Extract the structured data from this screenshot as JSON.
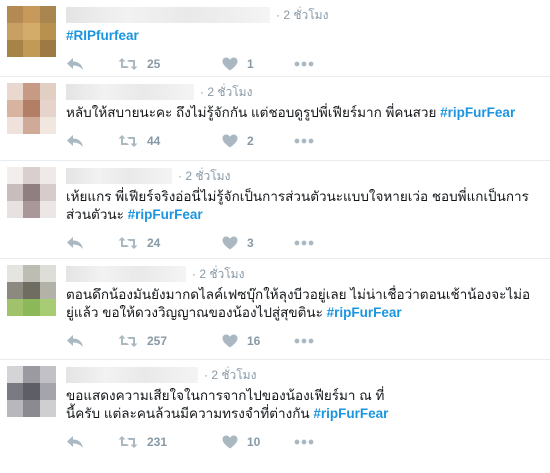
{
  "colors": {
    "hashtag": "#1b95e0",
    "icon": "#aab8c2",
    "text": "#14171a",
    "meta": "#8899a6"
  },
  "tweets": [
    {
      "time": "· 2 ชั่วโมง",
      "text_before": "",
      "hashtag": "#RIPfurfear",
      "retweets": "25",
      "likes": "1"
    },
    {
      "time": "· 2 ชั่วโมง",
      "text_before": "หลับให้สบายนะคะ ถึงไม่รู้จักกัน แต่ชอบดูรูปพี่เฟียร์มาก พี่คนสวย ",
      "hashtag": "#ripFurFear",
      "retweets": "44",
      "likes": "2"
    },
    {
      "time": "· 2 ชั่วโมง",
      "text_before": "เห้ยแกร พี่เฟียร์จริงอ่อนี่ไม่รู้จักเป็นการส่วนตัวนะแบบใจหายเว่อ ชอบพี่แกเป็นการส่วนตัวนะ ",
      "hashtag": "#ripFurFear",
      "retweets": "24",
      "likes": "3"
    },
    {
      "time": "· 2 ชั่วโมง",
      "text_before": "ตอนดึกน้องมันยังมากดไลค์เฟซบุ๊กให้ลุงบีวอยู่เลย ไม่น่าเชื่อว่าตอนเช้าน้องจะไม่อยู่แล้ว ขอให้ดวงวิญญาณของน้องไปสู่สุขตินะ ",
      "hashtag": "#ripFurFear",
      "retweets": "257",
      "likes": "16"
    },
    {
      "time": "· 2 ชั่วโมง",
      "text_before": "ขอแสดงความเสียใจในการจากไปของน้องเฟียร์มา ณ ที่นี้ครับ แต่ละคนล้วนมีความทรงจำที่ต่างกัน ",
      "hashtag": "#ripFurFear",
      "retweets": "231",
      "likes": "10"
    }
  ]
}
